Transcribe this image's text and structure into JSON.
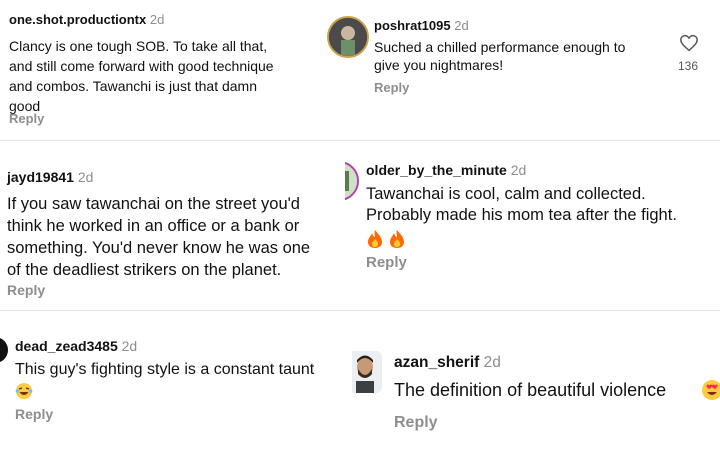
{
  "comments": [
    {
      "username": "one.shot.productiontx",
      "time": "2d",
      "lines": [
        "Clancy is one tough SOB. To take all that,",
        "and still come forward with good technique",
        "and combos. Tawanchi is just that damn",
        "good"
      ],
      "reply": "Reply"
    },
    {
      "username": "poshrat1095",
      "time": "2d",
      "lines": [
        "Suched a chilled performance enough to",
        "give you nightmares!"
      ],
      "likes": "136",
      "reply": "Reply"
    },
    {
      "username": "jayd19841",
      "time": "2d",
      "lines": [
        "If you saw tawanchai on the street you'd",
        "think he worked in an office or a bank or",
        "something. You'd never know he was one",
        "of the deadliest strikers on the planet."
      ],
      "reply": "Reply"
    },
    {
      "username": "older_by_the_minute",
      "time": "2d",
      "lines": [
        "Tawanchai is cool, calm and collected.",
        "Probably made his mom tea after the fight."
      ],
      "emoji": "fire-emoji x2",
      "reply": "Reply"
    },
    {
      "username": "dead_zead3485",
      "time": "2d",
      "lines": [
        "This guy's fighting style is a constant taunt"
      ],
      "emoji": "laughing-emoji",
      "reply": "Reply"
    },
    {
      "username": "azan_sherif",
      "time": "2d",
      "lines": [
        "The definition of beautiful violence"
      ],
      "emoji": "heart-eyes-emoji",
      "reply": "Reply"
    }
  ],
  "colors": {
    "text": "#111111",
    "muted": "#8e8e8e",
    "divider": "#e6e6e6",
    "fire": "#ff6a00"
  }
}
